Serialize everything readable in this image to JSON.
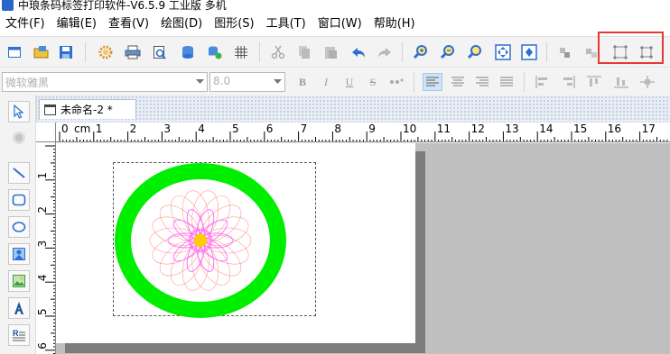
{
  "window": {
    "title": "中琅条码标签打印软件-V6.5.9 工业版 多机"
  },
  "menubar": {
    "items": [
      {
        "label": "文件(F)"
      },
      {
        "label": "编辑(E)"
      },
      {
        "label": "查看(V)"
      },
      {
        "label": "绘图(D)"
      },
      {
        "label": "图形(S)"
      },
      {
        "label": "工具(T)"
      },
      {
        "label": "窗口(W)"
      },
      {
        "label": "帮助(H)"
      }
    ]
  },
  "format_toolbar": {
    "font_family": "微软雅黑",
    "font_size": "8.0",
    "bold_label": "B",
    "italic_label": "I",
    "underline_label": "U",
    "strike_label": "S"
  },
  "document": {
    "tab_label": "未命名-2 *"
  },
  "ruler": {
    "unit": "cm",
    "h_ticks": [
      "0",
      "1",
      "2",
      "3",
      "4",
      "5",
      "6",
      "7",
      "8",
      "9",
      "10",
      "11",
      "12",
      "13",
      "14",
      "15",
      "16",
      "17"
    ],
    "v_ticks": [
      "1",
      "2",
      "3",
      "4",
      "5",
      "6"
    ]
  },
  "canvas": {
    "ring_color": "#00ee00",
    "rosette_colors": [
      "#ff8080",
      "#ff66ff",
      "#ffcc00"
    ]
  }
}
